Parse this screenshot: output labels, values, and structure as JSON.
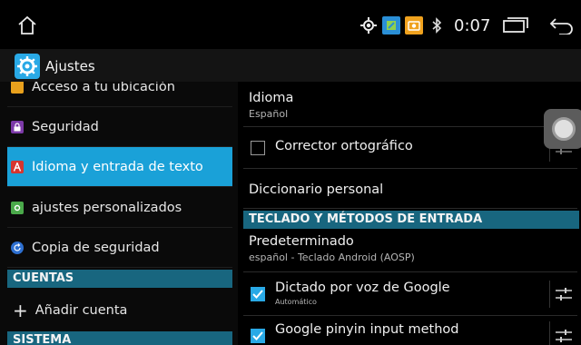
{
  "status_bar": {
    "icons": [
      "home-icon",
      "location-icon",
      "android-icon",
      "camera-icon",
      "bluetooth-icon"
    ],
    "time": "0:07",
    "colors": {
      "blue_badge": "#2a8fd6",
      "orange_badge": "#f0a21e"
    }
  },
  "action_bar": {
    "title": "Ajustes",
    "icon": "settings-gear-icon"
  },
  "left_nav": {
    "items": [
      {
        "label": "Acceso a tu ubicación",
        "icon": "location-icon",
        "icon_color": "#e9a11d"
      },
      {
        "label": "Seguridad",
        "icon": "lock-icon",
        "icon_color": "#7c3aa8"
      },
      {
        "label": "Idioma y entrada de texto",
        "icon": "language-icon",
        "icon_color": "#d6352f"
      },
      {
        "label": "ajustes personalizados",
        "icon": "custom-settings-icon",
        "icon_color": "#4aa94a"
      },
      {
        "label": "Copia de seguridad",
        "icon": "backup-icon",
        "icon_color": "#2d6fd0"
      }
    ],
    "accounts_header": "CUENTAS",
    "add_account": "Añadir cuenta",
    "system_header": "SISTEMA"
  },
  "right_pane": {
    "language": {
      "title": "Idioma",
      "value": "Español"
    },
    "spell_checker": {
      "title": "Corrector ortográfico",
      "checked": false
    },
    "personal_dictionary": {
      "title": "Diccionario personal"
    },
    "keyboard_section_header": "TECLADO Y MÉTODOS DE ENTRADA",
    "default_input": {
      "title": "Predeterminado",
      "value": "español - Teclado Android (AOSP)"
    },
    "google_voice": {
      "title": "Dictado por voz de Google",
      "subtitle": "Automático",
      "checked": true
    },
    "pinyin": {
      "title": "Google pinyin input method",
      "checked": true
    }
  },
  "accent_colors": {
    "selected": "#1aa1d8",
    "header": "#18667f",
    "checkbox": "#29a9e6"
  }
}
